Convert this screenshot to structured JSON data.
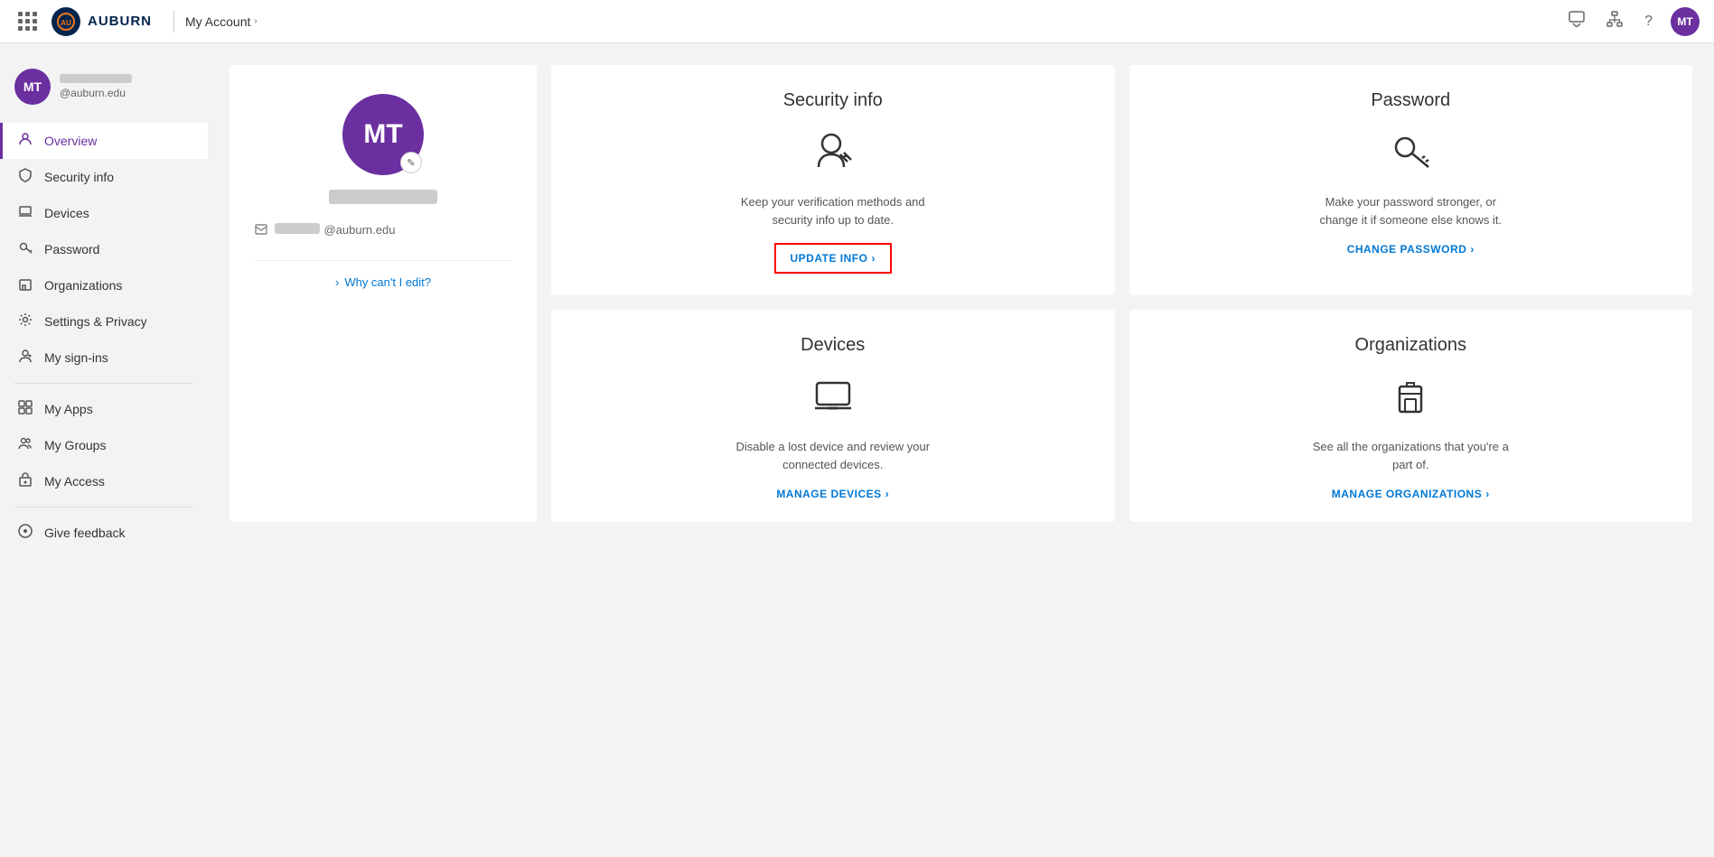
{
  "nav": {
    "brand": "AUBURN",
    "title": "My Account",
    "chevron": "›",
    "user_initials": "MT",
    "icons": {
      "waffle": "waffle-icon",
      "feedback": "feedback-icon",
      "org": "org-icon",
      "help": "help-icon",
      "user": "user-icon"
    }
  },
  "sidebar": {
    "user_initials": "MT",
    "user_email": "@auburn.edu",
    "items": [
      {
        "id": "overview",
        "label": "Overview",
        "icon": "person",
        "active": true
      },
      {
        "id": "security-info",
        "label": "Security info",
        "icon": "shield"
      },
      {
        "id": "devices",
        "label": "Devices",
        "icon": "laptop"
      },
      {
        "id": "password",
        "label": "Password",
        "icon": "key"
      },
      {
        "id": "organizations",
        "label": "Organizations",
        "icon": "building"
      },
      {
        "id": "settings-privacy",
        "label": "Settings & Privacy",
        "icon": "gear"
      },
      {
        "id": "my-signins",
        "label": "My sign-ins",
        "icon": "signin"
      },
      {
        "id": "my-apps",
        "label": "My Apps",
        "icon": "apps"
      },
      {
        "id": "my-groups",
        "label": "My Groups",
        "icon": "group"
      },
      {
        "id": "my-access",
        "label": "My Access",
        "icon": "access"
      },
      {
        "id": "give-feedback",
        "label": "Give feedback",
        "icon": "feedback"
      }
    ]
  },
  "profile_card": {
    "initials": "MT",
    "email_suffix": "@auburn.edu",
    "why_edit_label": "Why can't I edit?"
  },
  "security_info_card": {
    "title": "Security info",
    "description": "Keep your verification methods and security info up to date.",
    "action_label": "UPDATE INFO",
    "action_arrow": "›"
  },
  "password_card": {
    "title": "Password",
    "description": "Make your password stronger, or change it if someone else knows it.",
    "action_label": "CHANGE PASSWORD",
    "action_arrow": "›"
  },
  "devices_card": {
    "title": "Devices",
    "description": "Disable a lost device and review your connected devices.",
    "action_label": "MANAGE DEVICES",
    "action_arrow": "›"
  },
  "organizations_card": {
    "title": "Organizations",
    "description": "See all the organizations that you're a part of.",
    "action_label": "MANAGE ORGANIZATIONS",
    "action_arrow": "›"
  }
}
